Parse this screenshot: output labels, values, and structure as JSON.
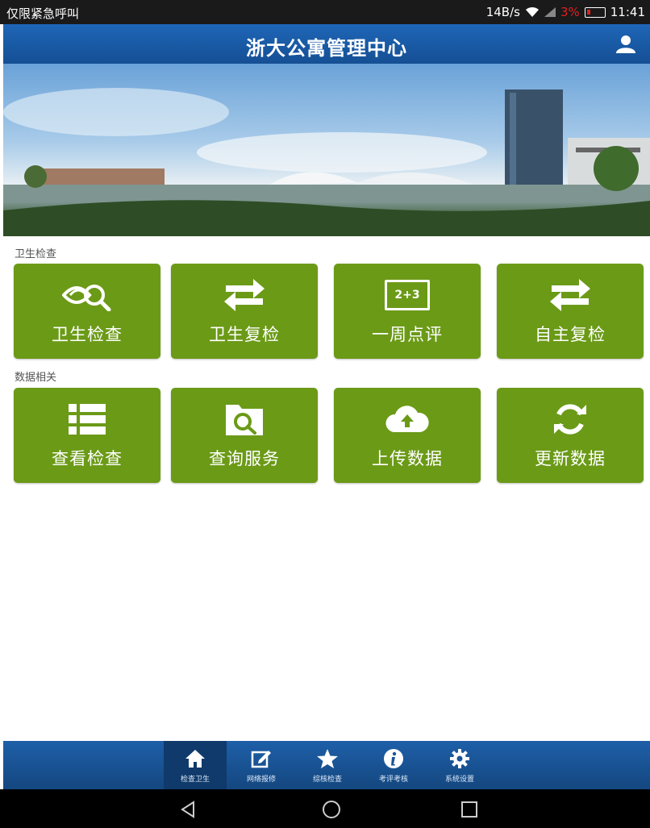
{
  "status_bar": {
    "carrier_text": "仅限紧急呼叫",
    "speed": "14B/s",
    "battery_pct": "3%",
    "time": "11:41"
  },
  "header": {
    "title": "浙大公寓管理中心",
    "user_icon": "user-icon"
  },
  "sections": {
    "hygiene": {
      "label": "卫生检查",
      "tiles": [
        {
          "label": "卫生检查",
          "icon": "eye-search-icon"
        },
        {
          "label": "卫生复检",
          "icon": "swap-arrows-icon"
        },
        {
          "label": "一周点评",
          "icon": "score-board-icon",
          "icon_text": "2+3"
        },
        {
          "label": "自主复检",
          "icon": "swap-arrows-icon"
        }
      ]
    },
    "data": {
      "label": "数据相关",
      "tiles": [
        {
          "label": "查看检查",
          "icon": "list-icon"
        },
        {
          "label": "查询服务",
          "icon": "folder-search-icon"
        },
        {
          "label": "上传数据",
          "icon": "cloud-upload-icon"
        },
        {
          "label": "更新数据",
          "icon": "refresh-icon"
        }
      ]
    }
  },
  "tab_bar": {
    "tabs": [
      {
        "label": "检查卫生",
        "icon": "home-icon",
        "active": true
      },
      {
        "label": "网络报修",
        "icon": "edit-icon",
        "active": false
      },
      {
        "label": "综核检查",
        "icon": "star-icon",
        "active": false
      },
      {
        "label": "考评考核",
        "icon": "info-icon",
        "active": false
      },
      {
        "label": "系统设置",
        "icon": "gear-icon",
        "active": false
      }
    ]
  },
  "colors": {
    "tile_green": "#6b9a17",
    "header_blue": "#1e66b7",
    "tab_bar_blue": "#1e5fa8",
    "battery_red": "#e02020"
  }
}
